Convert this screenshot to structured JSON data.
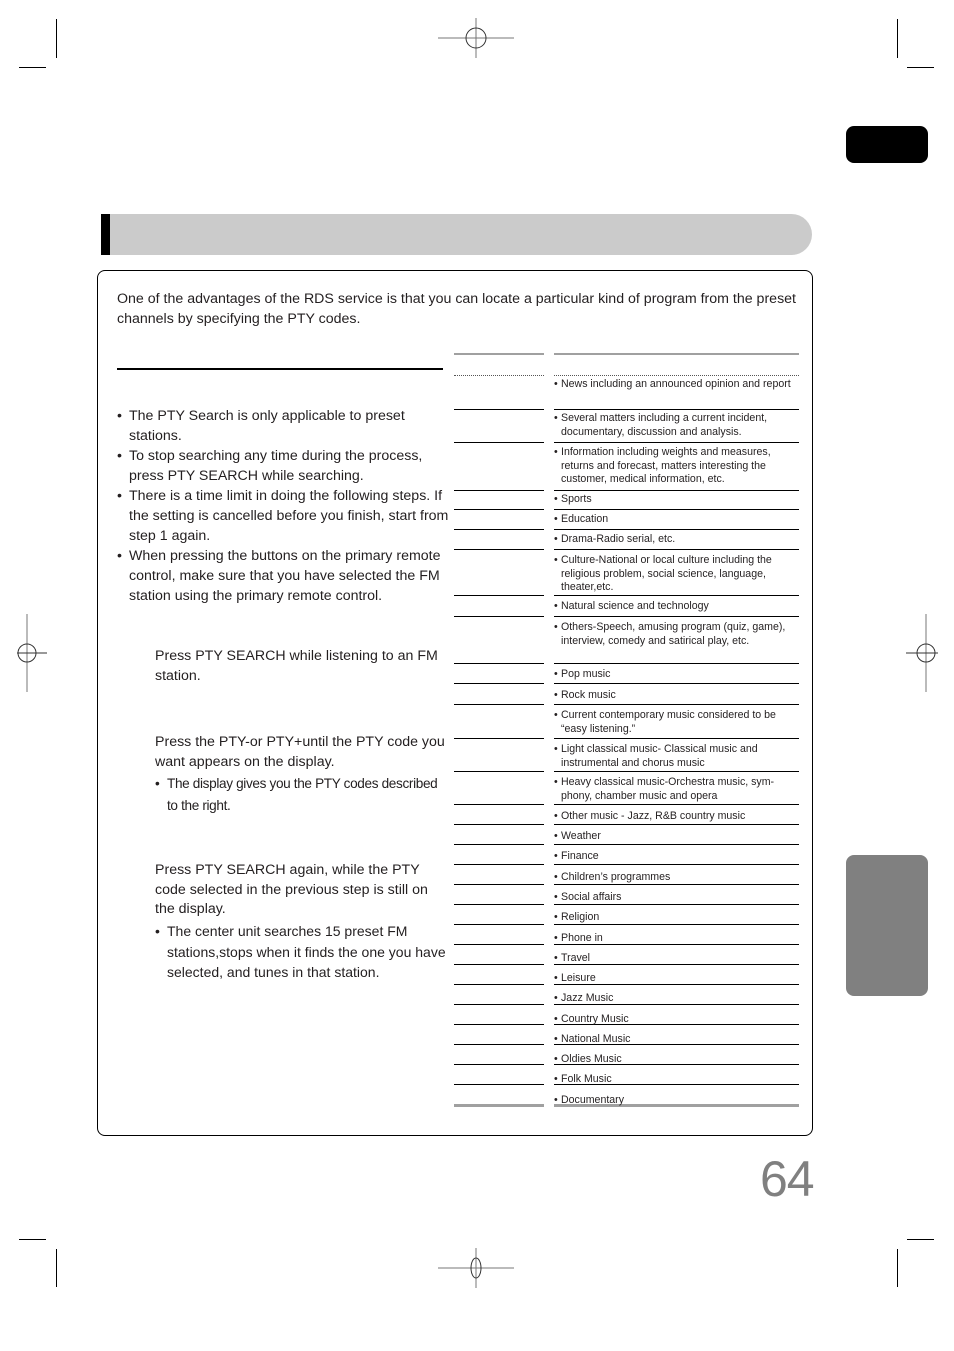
{
  "page": {
    "intro": "One  of the advantages of the RDS service is that you can locate a particular kind of program from the preset channels by specifying the PTY codes.",
    "page_number": "64",
    "colors": {
      "title_bar": "#cbcbcb",
      "language_tab": "#000000",
      "section_tab": "#808080",
      "page_number": "#808080"
    }
  },
  "notes": [
    "The PTY Search is only applicable to preset stations.",
    "To stop searching any time during the process, press PTY SEARCH while searching.",
    "There is a time limit in doing the following steps. If the setting is cancelled before you finish, start from step 1 again.",
    "When pressing the buttons on the primary remote control, make sure that you have selected the FM station using the primary remote control."
  ],
  "steps": [
    {
      "text": "Press PTY SEARCH while listening to an FM station.",
      "sub": ""
    },
    {
      "text": "Press the PTY-or PTY+until the PTY code you want appears on the display.",
      "sub": "The display gives you the PTY codes described to the right."
    },
    {
      "text": "Press PTY SEARCH again, while the PTY code selected in the previous step is still on the display.",
      "sub": "The center unit searches 15 preset FM stations,stops when it finds the one you have selected, and tunes in that station."
    }
  ],
  "pty_table": {
    "bullet": "•",
    "rows": [
      "News including an announced opinion and report",
      "Several matters including a current incident, documentary, discussion and analysis.",
      " Information including weights and measures, returns and forecast, matters interesting the customer, medical information, etc.",
      "Sports",
      "Education",
      "Drama-Radio serial, etc.",
      "Culture-National or local culture including the religious problem, social science, language, theater,etc.",
      "Natural science and technology",
      "Others-Speech, amusing program (quiz, game), interview, comedy and satirical play, etc.",
      "Pop music",
      "Rock music",
      "Current contemporary music considered to be “easy listening.”",
      "Light classical music- Classical music and instrumental and chorus music",
      "Heavy classical  music-Orchestra music, sym-phony, chamber music and opera",
      "Other music - Jazz, R&B country music",
      "Weather",
      "Finance",
      "Children’s programmes",
      "Social affairs",
      "Religion",
      "Phone in",
      "Travel",
      "Leisure",
      "Jazz Music",
      "Country Music",
      "National Music",
      "Oldies Music",
      "Folk Music",
      "Documentary"
    ]
  }
}
